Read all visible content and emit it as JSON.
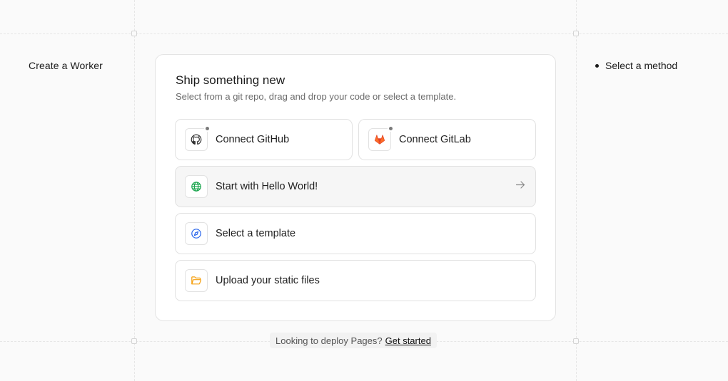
{
  "sidebar": {
    "title": "Create a Worker"
  },
  "steps": [
    {
      "label": "Select a method"
    }
  ],
  "card": {
    "title": "Ship something new",
    "subtitle": "Select from a git repo, drag and drop your code or select a template.",
    "options": {
      "github": {
        "label": "Connect GitHub",
        "icon": "github-icon"
      },
      "gitlab": {
        "label": "Connect GitLab",
        "icon": "gitlab-icon"
      },
      "hello": {
        "label": "Start with Hello World!",
        "icon": "globe-icon"
      },
      "template": {
        "label": "Select a template",
        "icon": "compass-icon"
      },
      "upload": {
        "label": "Upload your static files",
        "icon": "folder-icon"
      }
    }
  },
  "footer": {
    "text": "Looking to deploy Pages?",
    "link": "Get started"
  },
  "colors": {
    "gitlab": "#e24329",
    "globe": "#16a34a",
    "compass": "#2563eb",
    "folder": "#f59e0b"
  }
}
